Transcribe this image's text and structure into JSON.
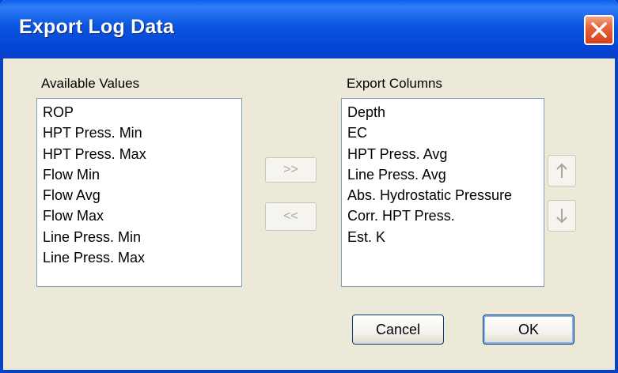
{
  "window": {
    "title": "Export Log Data"
  },
  "available": {
    "label": "Available Values",
    "items": [
      "ROP",
      "HPT Press. Min",
      "HPT Press. Max",
      "Flow Min",
      "Flow Avg",
      "Flow Max",
      "Line Press. Min",
      "Line Press. Max"
    ]
  },
  "export": {
    "label": "Export Columns",
    "items": [
      "Depth",
      "EC",
      "HPT Press. Avg",
      "Line Press. Avg",
      "Abs. Hydrostatic Pressure",
      "Corr. HPT Press.",
      "Est. K"
    ]
  },
  "transfer": {
    "add_label": ">>",
    "remove_label": "<<"
  },
  "order": {
    "up_icon": "arrow-up-icon",
    "down_icon": "arrow-down-icon"
  },
  "buttons": {
    "cancel": "Cancel",
    "ok": "OK"
  },
  "colors": {
    "titlebar": "#0a55e0",
    "close": "#e5643c",
    "dialog_bg": "#ece9d8",
    "list_border": "#7f9db9"
  }
}
